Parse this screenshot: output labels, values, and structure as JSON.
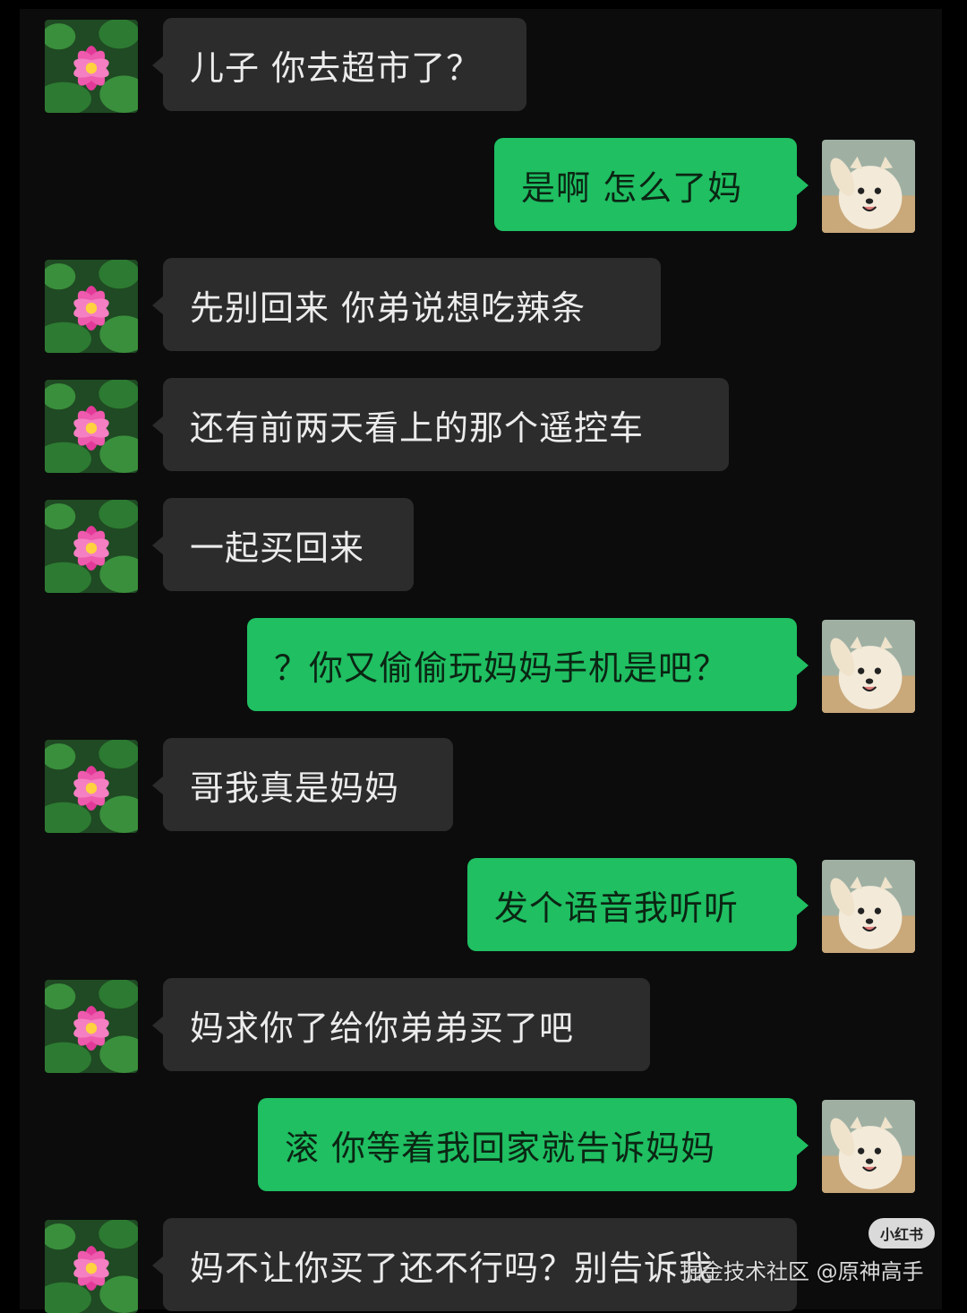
{
  "chat": {
    "messages": [
      {
        "side": "in",
        "text": "儿子 你去超市了？"
      },
      {
        "side": "out",
        "text": "是啊 怎么了妈"
      },
      {
        "side": "in",
        "text": "先别回来 你弟说想吃辣条"
      },
      {
        "side": "in",
        "text": "还有前两天看上的那个遥控车"
      },
      {
        "side": "in",
        "text": "一起买回来"
      },
      {
        "side": "out",
        "text": "？你又偷偷玩妈妈手机是吧？"
      },
      {
        "side": "in",
        "text": "哥我真是妈妈"
      },
      {
        "side": "out",
        "text": "发个语音我听听"
      },
      {
        "side": "in",
        "text": "妈求你了给你弟弟买了吧"
      },
      {
        "side": "out",
        "text": "滚 你等着我回家就告诉妈妈"
      },
      {
        "side": "in",
        "text": "妈不让你买了还不行吗？别告诉我"
      }
    ]
  },
  "overlay": {
    "logo": "小红书",
    "watermark": "掘金技术社区 @原神高手"
  },
  "colors": {
    "background": "#0c0c0c",
    "incoming_bubble": "#2c2c2c",
    "outgoing_bubble": "#1fbf62"
  },
  "icons": {
    "incoming_avatar": "lotus-flower-avatar",
    "outgoing_avatar": "samoyed-dog-avatar"
  }
}
